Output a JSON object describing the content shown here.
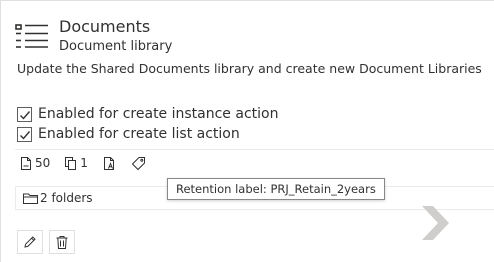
{
  "header": {
    "icon": "list-icon",
    "title": "Documents",
    "subtitle": "Document library"
  },
  "description": "Update the Shared Documents library and create new Document Libraries",
  "options": [
    {
      "label": "Enabled for create instance action",
      "checked": true
    },
    {
      "label": "Enabled for create list action",
      "checked": true
    }
  ],
  "stats": {
    "documents_count": "50",
    "versions_count": "1",
    "sensitivity_icon": "document-label-icon",
    "retention_icon": "tag-icon"
  },
  "tooltip": {
    "text": "Retention label: PRJ_Retain_2years"
  },
  "folders": {
    "label": "2 folders"
  },
  "actions": {
    "edit_icon": "pencil-icon",
    "delete_icon": "trash-icon"
  },
  "nav": {
    "next_icon": "chevron-right-icon"
  },
  "colors": {
    "checkbox_border": "#605e5c",
    "text": "#323130",
    "divider": "#edebe9",
    "chevron": "#c8c6c4"
  }
}
